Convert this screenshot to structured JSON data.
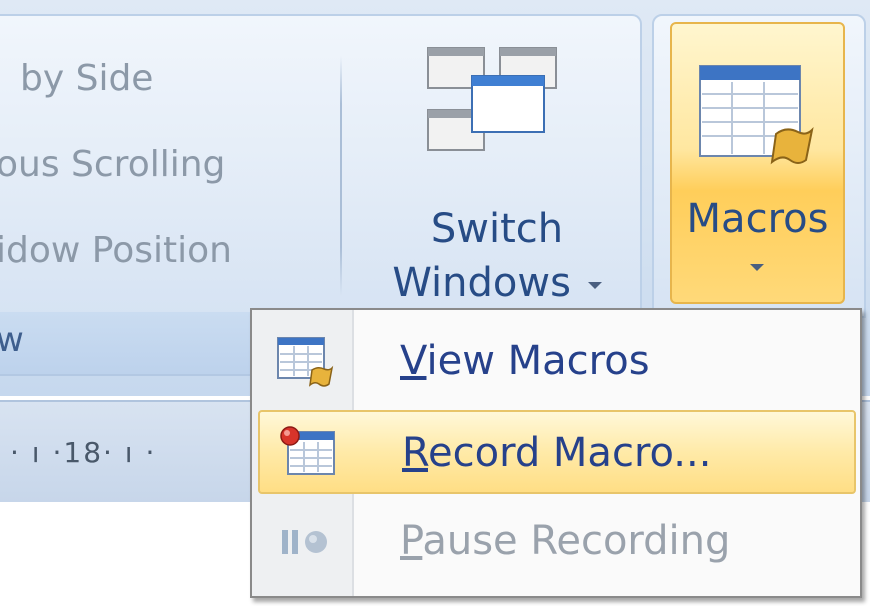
{
  "ribbon": {
    "window_group": {
      "side_by_side": "by Side",
      "sync_scrolling": "ous Scrolling",
      "reset_position": "idow Position",
      "group_label": "w"
    },
    "switch_windows": {
      "line1": "Switch",
      "line2": "Windows"
    },
    "macros": {
      "label": "Macros"
    }
  },
  "ruler": {
    "text": "· ı ·18· ı ·"
  },
  "menu": {
    "items": [
      {
        "accel": "V",
        "rest": "iew Macros",
        "icon": "macro-sheet-icon",
        "disabled": false
      },
      {
        "accel": "R",
        "rest": "ecord Macro...",
        "icon": "record-macro-icon",
        "disabled": false,
        "highlighted": true
      },
      {
        "accel": "P",
        "rest": "ause Recording",
        "icon": "pause-recording-icon",
        "disabled": true
      }
    ]
  },
  "colors": {
    "highlight": "#ffe7a0",
    "accent_text": "#26418b",
    "disabled_text": "#9aa2ac"
  }
}
